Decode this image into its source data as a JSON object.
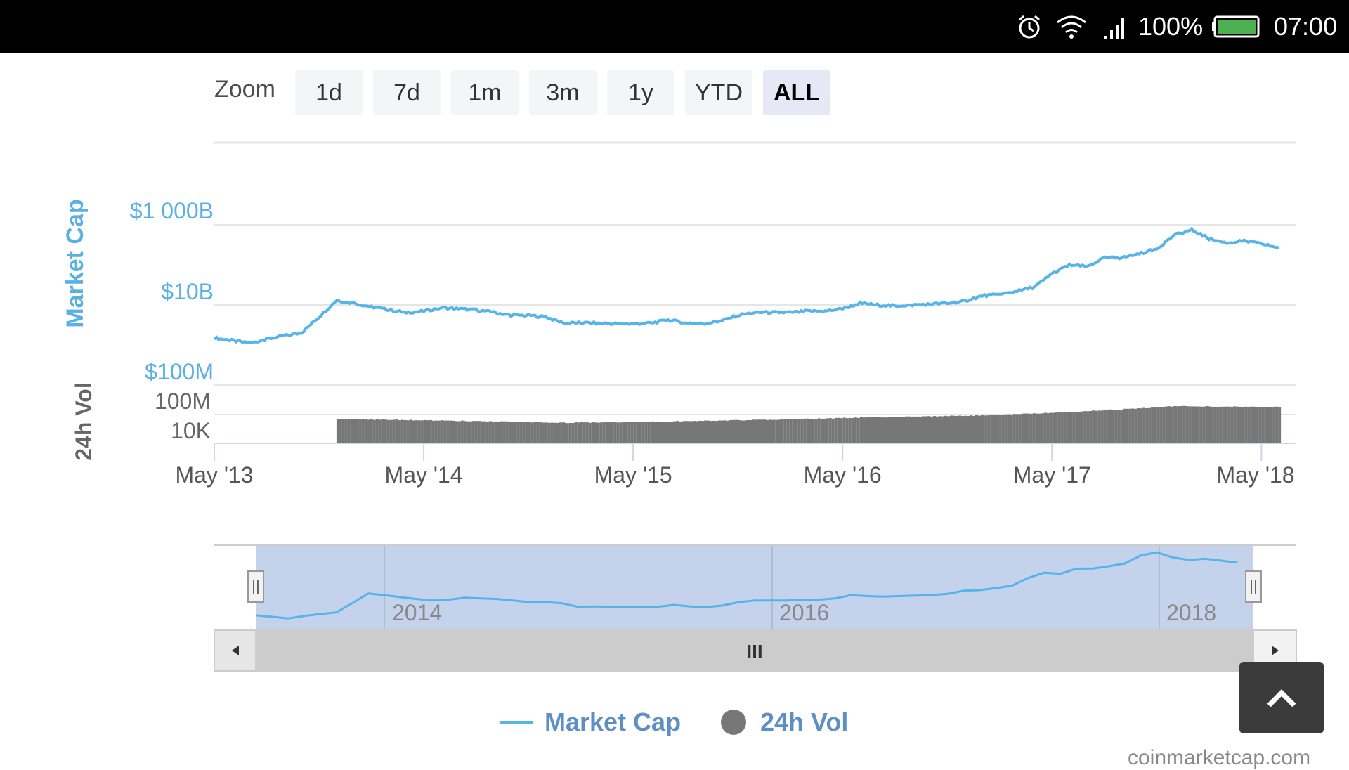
{
  "status_bar": {
    "battery_percent": "100%",
    "time": "07:00",
    "icons": [
      "alarm-icon",
      "wifi-icon",
      "signal-icon",
      "battery-icon"
    ],
    "battery_level": 1.0,
    "battery_color": "#4caf50"
  },
  "zoom": {
    "label": "Zoom",
    "buttons": [
      "1d",
      "7d",
      "1m",
      "3m",
      "1y",
      "YTD",
      "ALL"
    ],
    "active": "ALL"
  },
  "chart": {
    "y_axis_title": "Market Cap",
    "vol_axis_title": "24h Vol",
    "y_ticks": [
      "$1 000B",
      "$10B",
      "$100M"
    ],
    "vol_ticks": [
      "100M",
      "10K"
    ],
    "x_ticks": [
      "May '13",
      "May '14",
      "May '15",
      "May '16",
      "May '17",
      "May '18"
    ],
    "navigator_ticks": [
      "2014",
      "2016",
      "2018"
    ],
    "navigator_grip": "III",
    "colors": {
      "market_cap": "#56b4e9",
      "volume": "#777777",
      "navigator_fill": "#c5d2ec",
      "axis_label": "#5ab0e4"
    }
  },
  "legend": {
    "market_cap": "Market Cap",
    "volume": "24h Vol"
  },
  "footer": {
    "credit": "coinmarketcap.com"
  },
  "chart_data": {
    "type": "line",
    "y_scale": "log",
    "y_axis_label": "Market Cap",
    "ylim": [
      100000000,
      1000000000000
    ],
    "x_ticks": [
      "May '13",
      "May '14",
      "May '15",
      "May '16",
      "May '17",
      "May '18"
    ],
    "series": [
      {
        "name": "Market Cap",
        "type": "line",
        "x": [
          "2013-05",
          "2013-06",
          "2013-07",
          "2013-08",
          "2013-09",
          "2013-10",
          "2013-11",
          "2013-12",
          "2014-01",
          "2014-02",
          "2014-03",
          "2014-04",
          "2014-05",
          "2014-06",
          "2014-07",
          "2014-08",
          "2014-09",
          "2014-10",
          "2014-11",
          "2014-12",
          "2015-01",
          "2015-02",
          "2015-03",
          "2015-04",
          "2015-05",
          "2015-06",
          "2015-07",
          "2015-08",
          "2015-09",
          "2015-10",
          "2015-11",
          "2015-12",
          "2016-01",
          "2016-02",
          "2016-03",
          "2016-04",
          "2016-05",
          "2016-06",
          "2016-07",
          "2016-08",
          "2016-09",
          "2016-10",
          "2016-11",
          "2016-12",
          "2017-01",
          "2017-02",
          "2017-03",
          "2017-04",
          "2017-05",
          "2017-06",
          "2017-07",
          "2017-08",
          "2017-09",
          "2017-10",
          "2017-11",
          "2017-12",
          "2018-01",
          "2018-02",
          "2018-03",
          "2018-04",
          "2018-05",
          "2018-06"
        ],
        "values": [
          1500000000.0,
          1300000000.0,
          1100000000.0,
          1400000000.0,
          1700000000.0,
          2000000000.0,
          5000000000.0,
          13000000000.0,
          11000000000.0,
          9000000000.0,
          7500000000.0,
          6500000000.0,
          7000000000.0,
          8500000000.0,
          8000000000.0,
          7500000000.0,
          6500000000.0,
          5500000000.0,
          5500000000.0,
          5000000000.0,
          3500000000.0,
          3600000000.0,
          3500000000.0,
          3400000000.0,
          3400000000.0,
          3500000000.0,
          4200000000.0,
          3600000000.0,
          3400000000.0,
          3900000000.0,
          5500000000.0,
          6500000000.0,
          6500000000.0,
          6500000000.0,
          7000000000.0,
          7000000000.0,
          8000000000.0,
          11000000000.0,
          10000000000.0,
          9500000000.0,
          10000000000.0,
          10500000000.0,
          11000000000.0,
          12500000000.0,
          17000000000.0,
          18000000000.0,
          22000000000.0,
          28000000000.0,
          60000000000.0,
          100000000000.0,
          90000000000.0,
          150000000000.0,
          150000000000.0,
          190000000000.0,
          250000000000.0,
          550000000000.0,
          750000000000.0,
          450000000000.0,
          350000000000.0,
          400000000000.0,
          330000000000.0,
          270000000000.0
        ]
      },
      {
        "name": "24h Vol",
        "type": "column",
        "ylim": [
          1000,
          1000000000
        ],
        "x": [
          "2013-12",
          "2014-06",
          "2015-01",
          "2015-06",
          "2016-01",
          "2016-06",
          "2017-01",
          "2017-06",
          "2017-12",
          "2018-06"
        ],
        "values": [
          300000,
          200000,
          120000,
          150000,
          250000,
          400000,
          700000,
          1500000,
          6000000,
          5000000
        ]
      }
    ],
    "legend_position": "bottom-center",
    "grid": true
  }
}
